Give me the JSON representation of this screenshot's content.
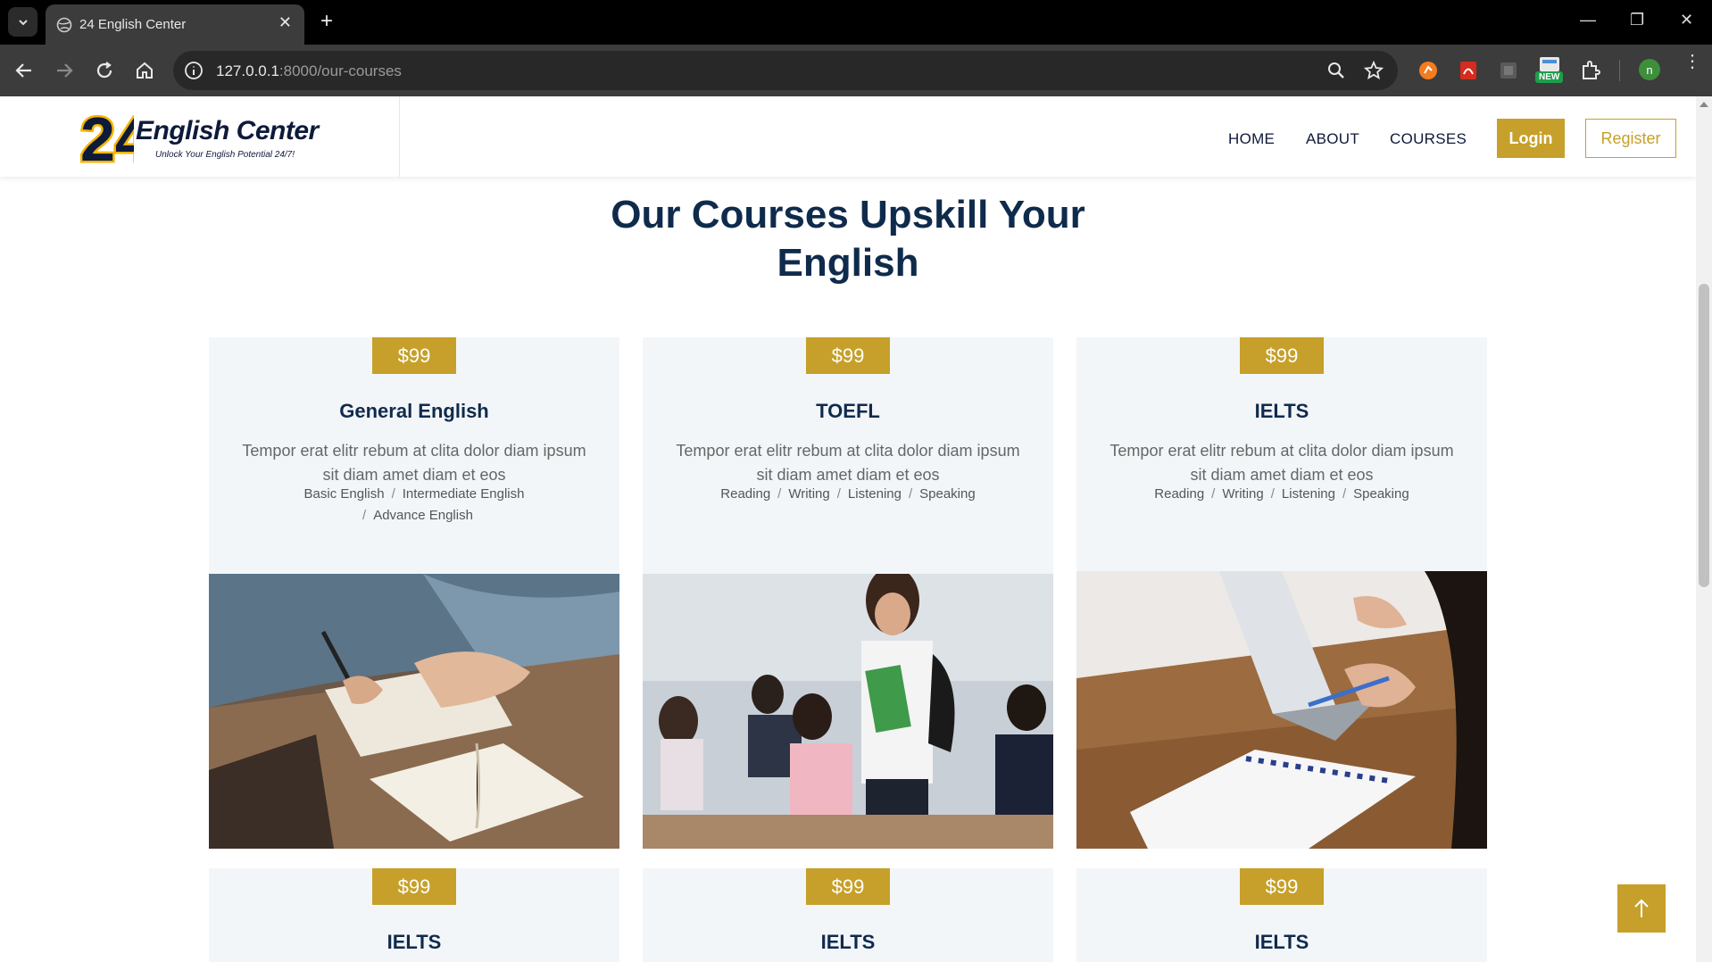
{
  "browser": {
    "tab_title": "24 English Center",
    "url_host": "127.0.0.1",
    "url_rest": ":8000/our-courses",
    "extension_badge": "NEW",
    "profile_initial": "n"
  },
  "site": {
    "logo_digits": "24",
    "logo_name": "English Center",
    "logo_tagline": "Unlock Your English Potential 24/7!",
    "nav": {
      "home": "HOME",
      "about": "ABOUT",
      "courses": "COURSES",
      "login": "Login",
      "register": "Register"
    },
    "heading_line1": "Our Courses Upskill Your",
    "heading_line2": "English"
  },
  "courses": [
    {
      "price": "$99",
      "title": "General English",
      "desc": "Tempor erat elitr rebum at clita dolor diam ipsum sit diam amet diam et eos",
      "tags": [
        "Basic English",
        "Intermediate English",
        "Advance English"
      ]
    },
    {
      "price": "$99",
      "title": "TOEFL",
      "desc": "Tempor erat elitr rebum at clita dolor diam ipsum sit diam amet diam et eos",
      "tags": [
        "Reading",
        "Writing",
        "Listening",
        "Speaking"
      ]
    },
    {
      "price": "$99",
      "title": "IELTS",
      "desc": "Tempor erat elitr rebum at clita dolor diam ipsum sit diam amet diam et eos",
      "tags": [
        "Reading",
        "Writing",
        "Listening",
        "Speaking"
      ]
    },
    {
      "price": "$99",
      "title": "IELTS"
    },
    {
      "price": "$99",
      "title": "IELTS"
    },
    {
      "price": "$99",
      "title": "IELTS"
    }
  ],
  "colors": {
    "accent": "#c6a02a",
    "navy": "#0f2b4c",
    "card_bg": "#f3f6f9"
  }
}
